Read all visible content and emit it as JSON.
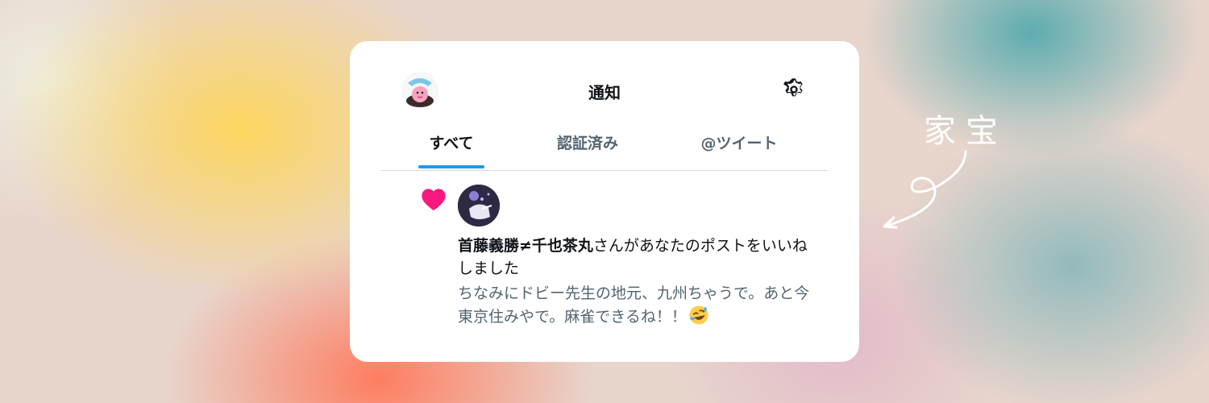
{
  "header": {
    "title": "通知",
    "avatar_icon": "kirby-avatar-icon",
    "settings_icon": "gear-icon"
  },
  "tabs": [
    {
      "label": "すべて",
      "active": true
    },
    {
      "label": "認証済み",
      "active": false
    },
    {
      "label": "@ツイート",
      "active": false
    }
  ],
  "notification": {
    "type_icon": "heart-icon",
    "liker_name": "首藤義勝≠千也茶丸",
    "action_text": "さんがあなたのポストをいいねしました",
    "tweet_text": "ちなみにドビー先生の地元、九州ちゃうで。あと今東京住みやで。麻雀できるね！！",
    "emoji": "rolling-on-floor-laughing-emoji"
  },
  "annotation": {
    "label": "家宝"
  },
  "colors": {
    "accent": "#1d9bf0",
    "heart": "#f91880",
    "text_primary": "#0f1419",
    "text_secondary": "#536471"
  }
}
